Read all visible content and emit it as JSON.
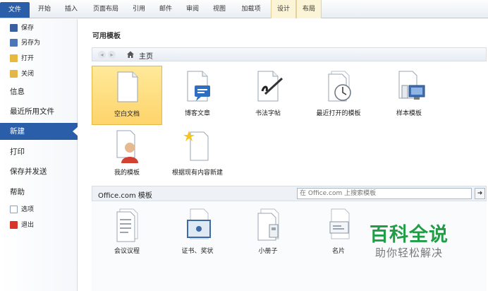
{
  "ribbon": {
    "tabs": [
      "文件",
      "开始",
      "插入",
      "页面布局",
      "引用",
      "邮件",
      "审阅",
      "视图",
      "加载项",
      "设计",
      "布局"
    ]
  },
  "leftnav": {
    "save": "保存",
    "save_as": "另存为",
    "open": "打开",
    "close": "关闭",
    "info": "信息",
    "recent": "最近所用文件",
    "new": "新建",
    "print": "打印",
    "save_send": "保存并发送",
    "help": "帮助",
    "options": "选项",
    "exit": "退出"
  },
  "main": {
    "available_templates_title": "可用模板",
    "nav": {
      "back": "◂",
      "forward": "▸",
      "home_label": "主页"
    },
    "templates": [
      {
        "label": "空白文档",
        "icon": "blank-document-icon",
        "selected": true
      },
      {
        "label": "博客文章",
        "icon": "blog-post-icon"
      },
      {
        "label": "书法字帖",
        "icon": "calligraphy-icon"
      },
      {
        "label": "最近打开的模板",
        "icon": "recent-templates-icon"
      },
      {
        "label": "样本模板",
        "icon": "sample-templates-icon"
      },
      {
        "label": "我的模板",
        "icon": "my-templates-icon"
      },
      {
        "label": "根据现有内容新建",
        "icon": "new-from-existing-icon"
      }
    ],
    "office_title": "Office.com 模板",
    "search_placeholder": "在 Office.com 上搜索模板",
    "search_go": "➜",
    "office_templates": [
      {
        "label": "会议议程",
        "icon": "agenda-icon"
      },
      {
        "label": "证书、奖状",
        "icon": "certificate-icon"
      },
      {
        "label": "小册子",
        "icon": "brochure-icon"
      },
      {
        "label": "名片",
        "icon": "business-card-icon"
      }
    ]
  },
  "watermark": {
    "main": "百科全说",
    "sub": "助你轻松解决"
  },
  "colors": {
    "accent": "#2a5ea9",
    "selected": "#fed46b",
    "watermark": "#1f9e46"
  }
}
